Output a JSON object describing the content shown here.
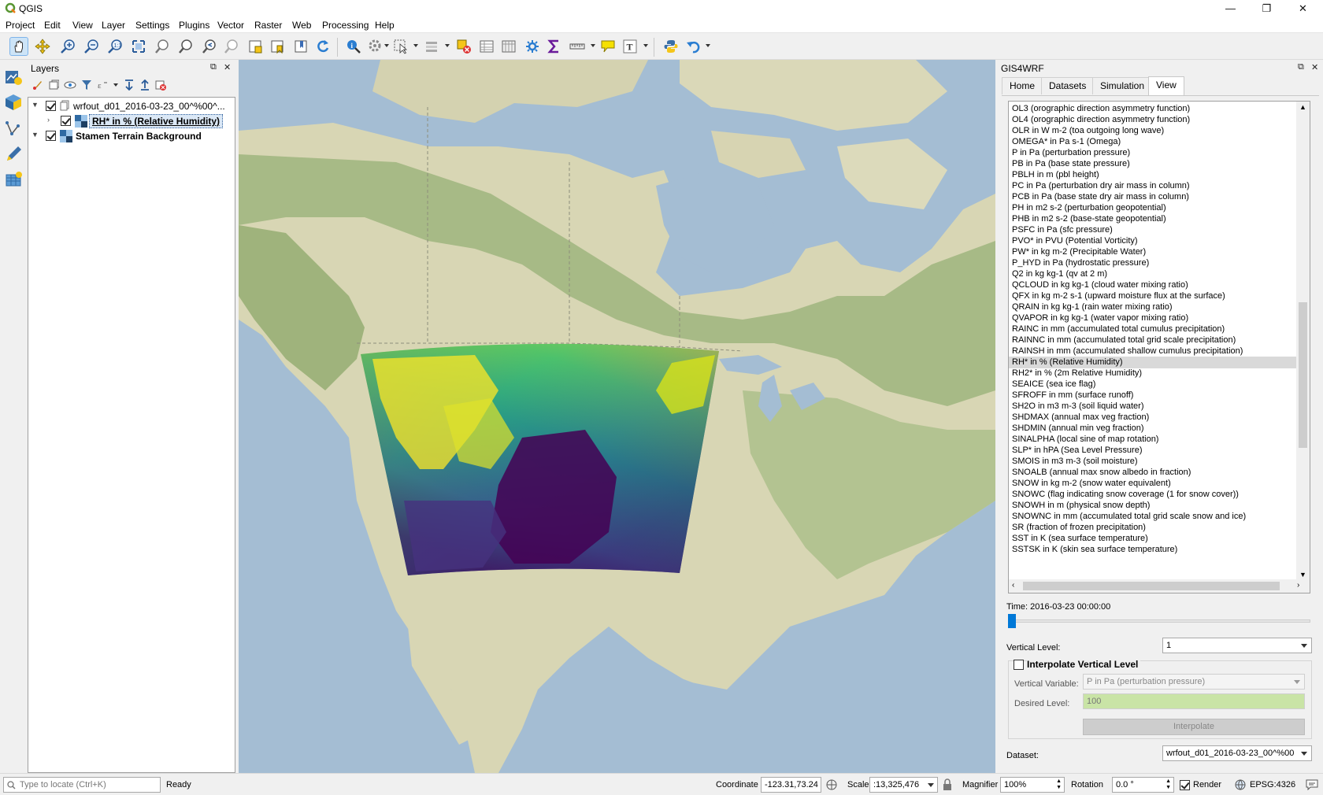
{
  "window": {
    "title": "QGIS",
    "minimize": "—",
    "restore": "❐",
    "close": "✕"
  },
  "menu": [
    "Project",
    "Edit",
    "View",
    "Layer",
    "Settings",
    "Plugins",
    "Vector",
    "Raster",
    "Web",
    "Processing",
    "Help"
  ],
  "layers_panel": {
    "title": "Layers",
    "float": "⧉",
    "close": "✕",
    "items": [
      {
        "label": "wrfout_d01_2016-03-23_00^%00^...",
        "checked": true
      },
      {
        "label": "RH* in % (Relative Humidity)",
        "checked": true
      },
      {
        "label": "Stamen Terrain Background",
        "checked": true
      }
    ]
  },
  "gis4wrf": {
    "title": "GIS4WRF",
    "float": "⧉",
    "close": "✕",
    "tabs": [
      "Home",
      "Datasets",
      "Simulation",
      "View"
    ],
    "active_tab": "View",
    "variables": [
      "OL3 (orographic direction asymmetry function)",
      "OL4 (orographic direction asymmetry function)",
      "OLR in W m-2 (toa outgoing long wave)",
      "OMEGA* in Pa s-1 (Omega)",
      "P in Pa (perturbation pressure)",
      "PB in Pa (base state pressure)",
      "PBLH in m (pbl height)",
      "PC in Pa (perturbation dry air mass in column)",
      "PCB in Pa (base state dry air mass in column)",
      "PH in m2 s-2 (perturbation geopotential)",
      "PHB in m2 s-2 (base-state geopotential)",
      "PSFC in Pa (sfc pressure)",
      "PVO* in PVU (Potential Vorticity)",
      "PW* in kg m-2 (Precipitable Water)",
      "P_HYD in Pa (hydrostatic pressure)",
      "Q2 in kg kg-1 (qv at 2 m)",
      "QCLOUD in kg kg-1 (cloud water mixing ratio)",
      "QFX in kg m-2 s-1 (upward moisture flux at the surface)",
      "QRAIN in kg kg-1 (rain water mixing ratio)",
      "QVAPOR in kg kg-1 (water vapor mixing ratio)",
      "RAINC in mm (accumulated total cumulus precipitation)",
      "RAINNC in mm (accumulated total grid scale precipitation)",
      "RAINSH in mm (accumulated shallow cumulus precipitation)",
      "RH* in % (Relative Humidity)",
      "RH2* in % (2m Relative Humidity)",
      "SEAICE (sea ice flag)",
      "SFROFF in mm (surface runoff)",
      "SH2O in m3 m-3 (soil liquid water)",
      "SHDMAX (annual max veg fraction)",
      "SHDMIN (annual min veg fraction)",
      "SINALPHA (local sine of map rotation)",
      "SLP* in hPA (Sea Level Pressure)",
      "SMOIS in m3 m-3 (soil moisture)",
      "SNOALB (annual max snow albedo in fraction)",
      "SNOW in kg m-2 (snow water equivalent)",
      "SNOWC (flag indicating snow coverage (1 for snow cover))",
      "SNOWH in m (physical snow depth)",
      "SNOWNC in mm (accumulated total grid scale snow and ice)",
      "SR (fraction of frozen precipitation)",
      "SST in K (sea surface temperature)",
      "SSTSK in K (skin sea surface temperature)"
    ],
    "selected_variable": "RH* in % (Relative Humidity)",
    "time_label": "Time: 2016-03-23 00:00:00",
    "time_slider_fraction": 0,
    "vertical_level_label": "Vertical Level:",
    "vertical_level_value": "1",
    "interpolate_label": "Interpolate Vertical Level",
    "interpolate_checked": false,
    "vertical_variable_label": "Vertical Variable:",
    "vertical_variable_value": "P in Pa (perturbation pressure)",
    "desired_level_label": "Desired Level:",
    "desired_level_value": "100",
    "interpolate_button": "Interpolate",
    "dataset_label": "Dataset:",
    "dataset_value": "wrfout_d01_2016-03-23_00^%00"
  },
  "status": {
    "locate_placeholder": "Type to locate (Ctrl+K)",
    "ready": "Ready",
    "coordinate_label": "Coordinate",
    "coordinate_value": "-123.31,73.24",
    "scale_label": "Scale",
    "scale_value": ":13,325,476",
    "magnifier_label": "Magnifier",
    "magnifier_value": "100%",
    "rotation_label": "Rotation",
    "rotation_value": "0.0 °",
    "render_label": "Render",
    "render_checked": true,
    "crs": "EPSG:4326"
  },
  "colors": {
    "accent": "#0078d7",
    "map_ocean": "#a4bdd3",
    "map_land": "#d8d6b4",
    "map_forest": "#a7ba86",
    "viridis_low": "#440154",
    "viridis_mid": "#21918c",
    "viridis_high": "#fde725",
    "interp_field": "#c9e4a6"
  }
}
